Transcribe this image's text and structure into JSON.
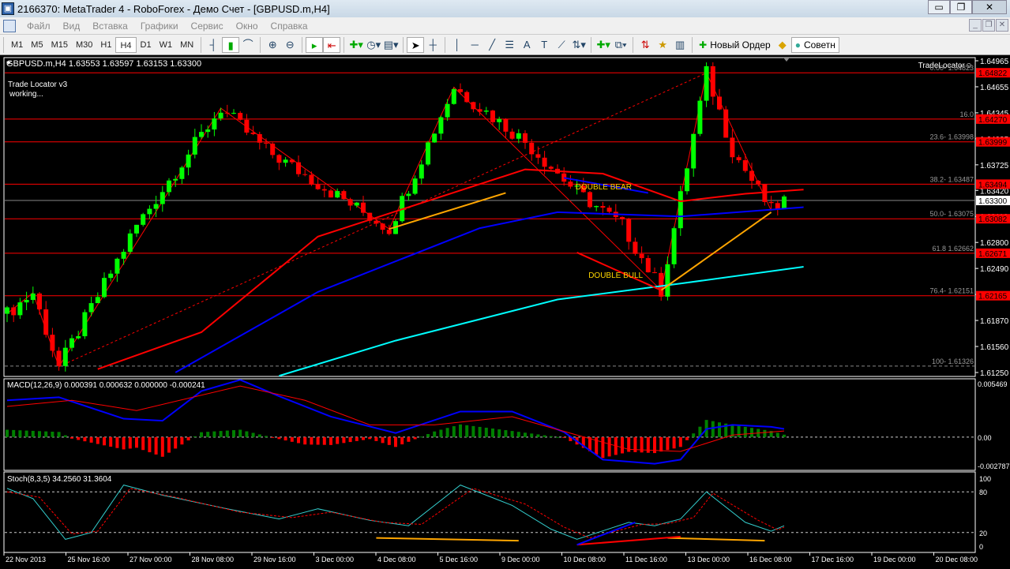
{
  "window": {
    "title": "2166370: MetaTrader 4 - RoboForex - Демо Счет - [GBPUSD.m,H4]"
  },
  "menu": [
    "Файл",
    "Вид",
    "Вставка",
    "Графики",
    "Сервис",
    "Окно",
    "Справка"
  ],
  "timeframes": [
    "M1",
    "M5",
    "M15",
    "M30",
    "H1",
    "H4",
    "D1",
    "W1",
    "MN"
  ],
  "active_timeframe": "H4",
  "toolbar": {
    "new_order": "Новый Ордер",
    "advisors": "Советн",
    "icons": [
      "bar-chart-icon",
      "candlestick-icon",
      "line-chart-icon",
      "zoom-in-icon",
      "zoom-out-icon",
      "auto-scroll-icon",
      "chart-shift-icon",
      "indicators-icon",
      "periods-icon",
      "templates-icon",
      "cursor-icon",
      "crosshair-icon",
      "vertical-line-icon",
      "horizontal-line-icon",
      "trendline-icon",
      "fibonacci-icon",
      "text-icon",
      "text-label-icon",
      "fan-icon",
      "arrows-icon",
      "new-chart-icon",
      "profiles-icon",
      "market-watch-icon",
      "navigator-icon",
      "terminal-icon"
    ]
  },
  "chart_header": "GBPUSD.m,H4  1.63553 1.63597 1.63153 1.63300",
  "indicator_text": {
    "line1": "Trade Locator v3",
    "line2": "working...",
    "corner": "TradeLocator☺"
  },
  "colors": {
    "bull": "#00ff00",
    "bear": "#ff0000",
    "ma_fast": "#ff0000",
    "ma_mid": "#0000ff",
    "ma_slow": "#00ffff",
    "zigzag": "#ff0000",
    "pattern": "#ffa500"
  },
  "chart_data": [
    {
      "type": "candlestick",
      "title": "GBPUSD.m,H4",
      "ylim": [
        1.6125,
        1.64965
      ],
      "price_ticks": [
        "1.64965",
        "1.64655",
        "1.64345",
        "1.64035",
        "1.63725",
        "1.63420",
        "1.63110",
        "1.62800",
        "1.62490",
        "1.62180",
        "1.61870",
        "1.61560",
        "1.61250"
      ],
      "level_tags": [
        1.64822,
        1.6427,
        1.63999,
        1.63494,
        1.63082,
        1.62671,
        1.62165
      ],
      "current_price": 1.633,
      "fib_levels": [
        {
          "label": "0.00- 1.64823",
          "price": 1.64822
        },
        {
          "label": "16.0",
          "price": 1.6427
        },
        {
          "label": "23.6- 1.63998",
          "price": 1.63999
        },
        {
          "label": "38.2- 1.63487",
          "price": 1.63494
        },
        {
          "label": "50.0- 1.63075",
          "price": 1.63082
        },
        {
          "label": "61.8 1.62662",
          "price": 1.62671
        },
        {
          "label": "76.4- 1.62151",
          "price": 1.62165
        },
        {
          "label": "100- 1.61326",
          "price": 1.61326
        }
      ],
      "bars": 121,
      "pivots": [
        [
          0,
          1.6195
        ],
        [
          4,
          1.622
        ],
        [
          8,
          1.6132
        ],
        [
          20,
          1.63
        ],
        [
          33,
          1.644
        ],
        [
          40,
          1.639
        ],
        [
          59,
          1.6296
        ],
        [
          69,
          1.6465
        ],
        [
          80,
          1.64
        ],
        [
          88,
          1.634
        ],
        [
          95,
          1.63
        ],
        [
          101,
          1.6223
        ],
        [
          108,
          1.6482
        ],
        [
          112,
          1.639
        ],
        [
          118,
          1.6318
        ],
        [
          120,
          1.633
        ]
      ],
      "ma_fast": [
        [
          14,
          1.6129
        ],
        [
          30,
          1.6173
        ],
        [
          48,
          1.6287
        ],
        [
          60,
          1.6317
        ],
        [
          80,
          1.6367
        ],
        [
          92,
          1.6362
        ],
        [
          104,
          1.6329
        ],
        [
          114,
          1.6338
        ],
        [
          123,
          1.6343
        ]
      ],
      "ma_mid": [
        [
          26,
          1.6125
        ],
        [
          48,
          1.6221
        ],
        [
          73,
          1.6297
        ],
        [
          85,
          1.6316
        ],
        [
          104,
          1.6311
        ],
        [
          123,
          1.6322
        ]
      ],
      "ma_slow": [
        [
          42,
          1.6121
        ],
        [
          60,
          1.6163
        ],
        [
          85,
          1.6212
        ],
        [
          104,
          1.6231
        ],
        [
          123,
          1.6251
        ]
      ],
      "annotations": [
        {
          "text": "DOUBLE  BEAR",
          "bar": 89,
          "price": 1.6343
        },
        {
          "text": "DOUBLE  BULL",
          "bar": 91,
          "price": 1.6238
        }
      ],
      "x_labels": [
        "22 Nov 2013",
        "25 Nov 16:00",
        "27 Nov 00:00",
        "28 Nov 08:00",
        "29 Nov 16:00",
        "3 Dec 00:00",
        "4 Dec 08:00",
        "5 Dec 16:00",
        "9 Dec 00:00",
        "10 Dec 08:00",
        "11 Dec 16:00",
        "13 Dec 00:00",
        "16 Dec 08:00",
        "17 Dec 16:00",
        "19 Dec 00:00",
        "20 Dec 08:00"
      ]
    },
    {
      "type": "line",
      "title": "MACD(12,26,9) 0.000391 0.000632 0.000000 -0.000241",
      "ylim": [
        -0.002787,
        0.005469
      ],
      "ticks": [
        "0.005469",
        "0.00",
        "-0.002787"
      ],
      "macd": [
        [
          0,
          0.0036
        ],
        [
          8,
          0.0039
        ],
        [
          18,
          0.0018
        ],
        [
          24,
          0.0016
        ],
        [
          30,
          0.0045
        ],
        [
          36,
          0.0056
        ],
        [
          42,
          0.004
        ],
        [
          50,
          0.002
        ],
        [
          60,
          0.0004
        ],
        [
          70,
          0.0025
        ],
        [
          78,
          0.0025
        ],
        [
          86,
          0.0005
        ],
        [
          92,
          -0.0022
        ],
        [
          100,
          -0.0026
        ],
        [
          104,
          -0.0022
        ],
        [
          108,
          0.0008
        ],
        [
          112,
          0.0012
        ],
        [
          118,
          0.001
        ],
        [
          120,
          0.0008
        ]
      ],
      "signal": [
        [
          0,
          0.003
        ],
        [
          10,
          0.0036
        ],
        [
          20,
          0.0026
        ],
        [
          36,
          0.005
        ],
        [
          46,
          0.0036
        ],
        [
          56,
          0.0012
        ],
        [
          66,
          0.0012
        ],
        [
          78,
          0.002
        ],
        [
          88,
          0.0002
        ],
        [
          96,
          -0.0012
        ],
        [
          104,
          -0.0014
        ],
        [
          112,
          0.0002
        ],
        [
          120,
          0.0006
        ]
      ]
    },
    {
      "type": "line",
      "title": "Stoch(8,3,5) 34.2560 31.3604",
      "ylim": [
        0,
        100
      ],
      "ticks": [
        "100",
        "80",
        "20",
        "0"
      ],
      "main": [
        [
          0,
          85
        ],
        [
          4,
          70
        ],
        [
          9,
          10
        ],
        [
          13,
          20
        ],
        [
          18,
          90
        ],
        [
          24,
          75
        ],
        [
          34,
          55
        ],
        [
          42,
          40
        ],
        [
          48,
          55
        ],
        [
          56,
          38
        ],
        [
          62,
          30
        ],
        [
          70,
          90
        ],
        [
          78,
          60
        ],
        [
          84,
          25
        ],
        [
          88,
          10
        ],
        [
          96,
          35
        ],
        [
          100,
          30
        ],
        [
          104,
          40
        ],
        [
          108,
          80
        ],
        [
          114,
          35
        ],
        [
          118,
          22
        ],
        [
          120,
          30
        ]
      ],
      "signal": [
        [
          0,
          80
        ],
        [
          5,
          72
        ],
        [
          10,
          18
        ],
        [
          14,
          22
        ],
        [
          19,
          85
        ],
        [
          26,
          72
        ],
        [
          36,
          50
        ],
        [
          44,
          42
        ],
        [
          50,
          50
        ],
        [
          58,
          35
        ],
        [
          64,
          32
        ],
        [
          72,
          85
        ],
        [
          80,
          62
        ],
        [
          86,
          28
        ],
        [
          90,
          12
        ],
        [
          98,
          32
        ],
        [
          102,
          33
        ],
        [
          106,
          42
        ],
        [
          109,
          78
        ],
        [
          116,
          38
        ],
        [
          119,
          24
        ],
        [
          120,
          28
        ]
      ]
    }
  ]
}
